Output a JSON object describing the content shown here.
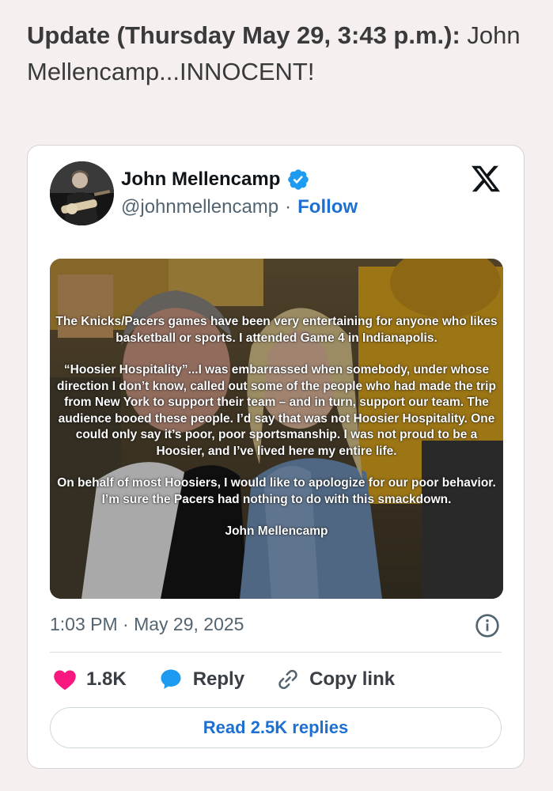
{
  "headline": {
    "bold_part": "Update (Thursday May 29, 3:43 p.m.):",
    "normal_part": " John Mellencamp...INNOCENT!"
  },
  "tweet": {
    "author_name": "John Mellencamp",
    "handle": "@johnmellencamp",
    "separator": "·",
    "follow_label": "Follow",
    "icons": {
      "verified": "verified-badge-icon",
      "platform": "x-logo-icon",
      "info": "info-icon",
      "like": "heart-icon",
      "reply": "speech-bubble-icon",
      "copy": "link-icon"
    },
    "image_text": {
      "p1": "The Knicks/Pacers games have been very entertaining for anyone who likes basketball or sports. I attended Game 4 in Indianapolis.",
      "p2": "“Hoosier Hospitality”...I was embarrassed when somebody, under whose direction I don’t know, called out some of the people who had made the trip from New York to support their team – and in turn, support our team. The audience booed these people. I’d say that was not Hoosier Hospitality. One could only say it’s poor, poor sportsmanship. I was not proud to be a Hoosier, and I’ve lived here my entire life.",
      "p3": "On behalf of most Hoosiers, I would like to apologize for our poor behavior. I’m sure the Pacers had nothing to do with this smackdown.",
      "p4": "John Mellencamp"
    },
    "timestamp": "1:03 PM · May 29, 2025",
    "likes_count": "1.8K",
    "reply_label": "Reply",
    "copy_link_label": "Copy link",
    "read_replies_label": "Read 2.5K replies"
  },
  "colors": {
    "accent_blue": "#1d6fd1",
    "heart_pink": "#f91880",
    "background": "#f5f0ef"
  }
}
